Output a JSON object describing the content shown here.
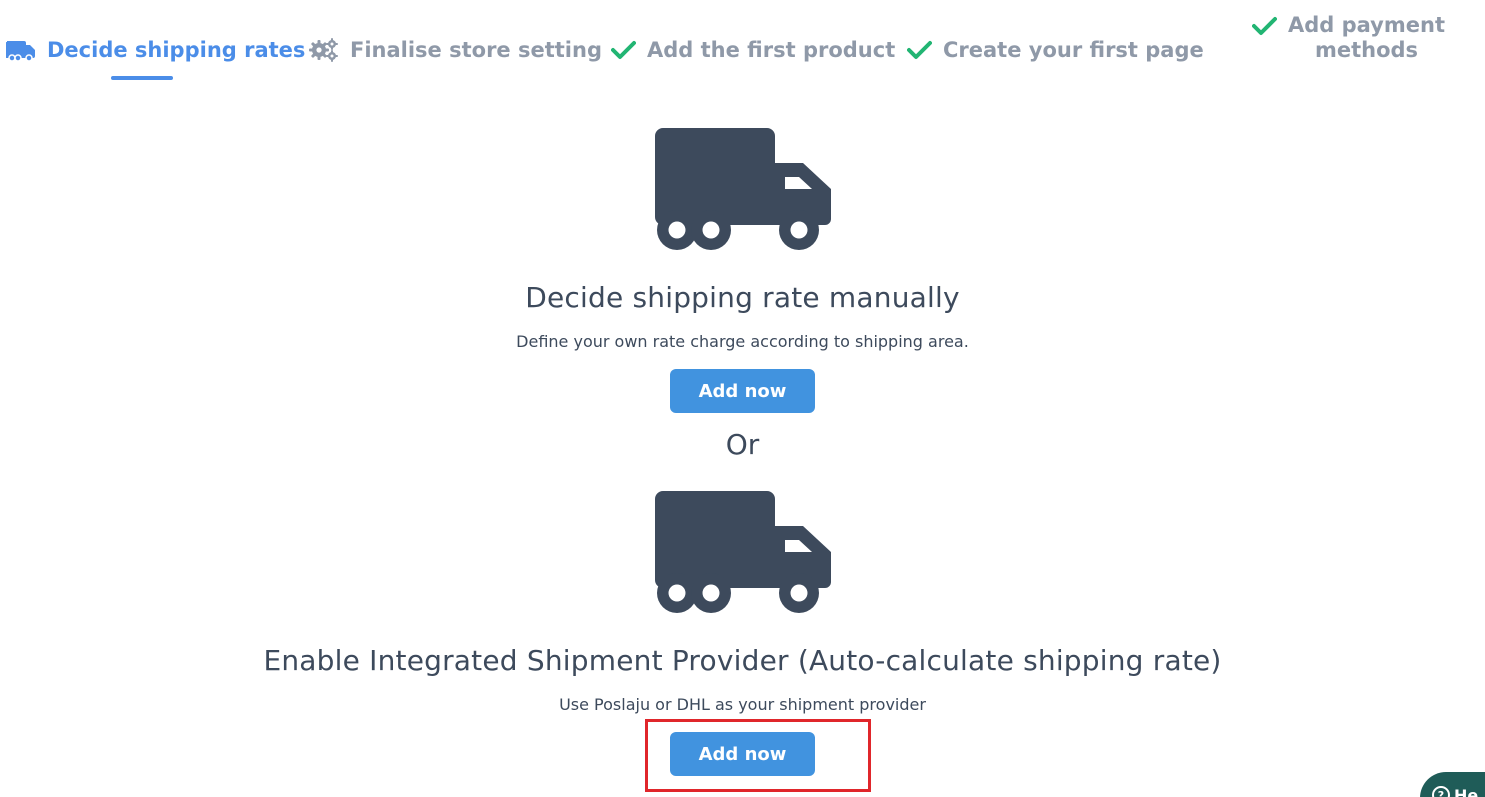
{
  "steps": [
    {
      "label": "Decide shipping rates",
      "icon": "truck-icon",
      "state": "active"
    },
    {
      "label": "Finalise store setting",
      "icon": "gears-icon",
      "state": "pending"
    },
    {
      "label": "Add the first product",
      "icon": "check-icon",
      "state": "done"
    },
    {
      "label": "Create your first page",
      "icon": "check-icon",
      "state": "done"
    },
    {
      "label_line1": "Add payment",
      "label_line2": "methods",
      "icon": "check-icon",
      "state": "done"
    }
  ],
  "options": [
    {
      "title": "Decide shipping rate manually",
      "description": "Define your own rate charge according to shipping area.",
      "button_label": "Add now",
      "icon": "truck-icon"
    },
    {
      "title": "Enable Integrated Shipment Provider (Auto-calculate shipping rate)",
      "description": "Use Poslaju or DHL as your shipment provider",
      "button_label": "Add now",
      "icon": "truck-icon"
    }
  ],
  "separator_text": "Or",
  "help_widget": {
    "label": "He",
    "icon": "question-icon"
  },
  "colors": {
    "active": "#4b8de8",
    "inactive": "#8f99a8",
    "check": "#22b573",
    "button": "#4193df",
    "truck": "#3d4a5c",
    "highlight": "#e0262b",
    "help_bg": "#1f5c58"
  }
}
